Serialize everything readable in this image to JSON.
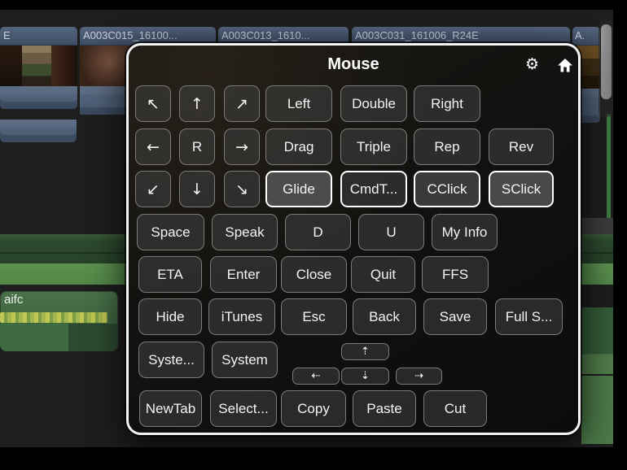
{
  "timeline": {
    "clips": [
      "E",
      "A003C015_16100...",
      "A003C013_1610...",
      "A003C031_161006_R24E",
      "A."
    ],
    "audio_label": "aifc"
  },
  "panel": {
    "title": "Mouse",
    "icons": {
      "gear": "⚙",
      "home": "home"
    },
    "arrows": {
      "nw": "↖",
      "n": "↑",
      "ne": "↗",
      "w": "←",
      "r": "R",
      "e": "→",
      "sw": "↙",
      "s": "↓",
      "se": "↘"
    },
    "buttons": {
      "left": "Left",
      "double": "Double",
      "right": "Right",
      "drag": "Drag",
      "triple": "Triple",
      "rep": "Rep",
      "rev": "Rev",
      "glide": "Glide",
      "cmdt": "CmdT...",
      "cclick": "CClick",
      "sclick": "SClick",
      "space": "Space",
      "speak": "Speak",
      "d": "D",
      "u": "U",
      "myinfo": "My Info",
      "eta": "ETA",
      "enter": "Enter",
      "close": "Close",
      "quit": "Quit",
      "ffs": "FFS",
      "hide": "Hide",
      "itunes": "iTunes",
      "esc": "Esc",
      "back": "Back",
      "save": "Save",
      "fulls": "Full S...",
      "syste": "Syste...",
      "system": "System",
      "scroll_up": "⇡",
      "scroll_left": "⇠",
      "scroll_down": "⇣",
      "scroll_right": "⇢",
      "newtab": "NewTab",
      "select": "Select...",
      "copy": "Copy",
      "paste": "Paste",
      "cut": "Cut"
    },
    "colors": {
      "highlight_border": "#ffffff",
      "button_border": "#7b7b7b"
    }
  }
}
